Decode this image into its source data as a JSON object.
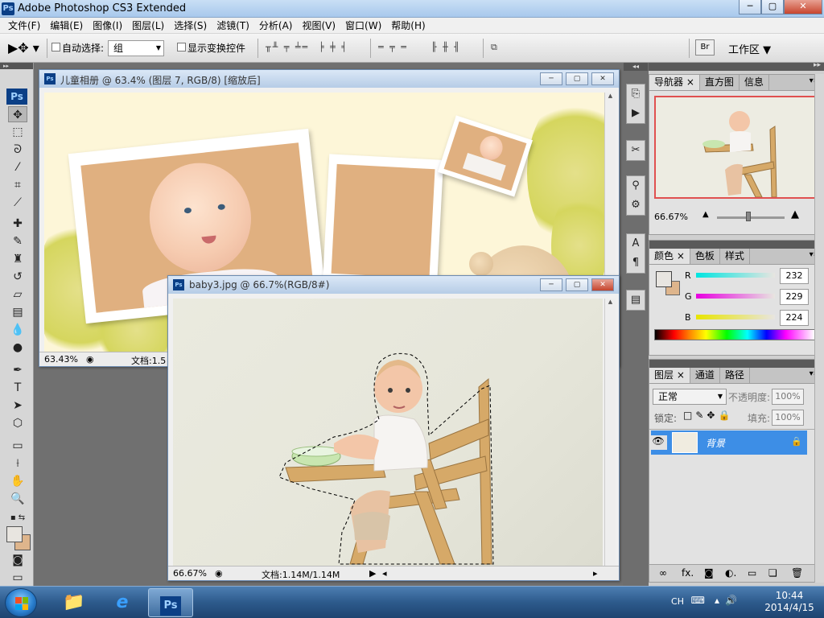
{
  "window": {
    "title": "Adobe Photoshop CS3 Extended",
    "app_icon": "Ps",
    "minimize": "─",
    "maximize": "▢",
    "close": "✕"
  },
  "menu": [
    "文件(F)",
    "编辑(E)",
    "图像(I)",
    "图层(L)",
    "选择(S)",
    "滤镜(T)",
    "分析(A)",
    "视图(V)",
    "窗口(W)",
    "帮助(H)"
  ],
  "options": {
    "auto_select_label": "自动选择:",
    "auto_select_value": "组",
    "show_transform_label": "显示变换控件",
    "workspace_label": "工作区 ▼",
    "bridge_icon": "Br"
  },
  "toolbox": {
    "logo": "Ps",
    "tools": [
      "move-tool",
      "marquee-tool",
      "lasso-tool",
      "magic-wand-tool",
      "crop-tool",
      "slice-tool",
      "healing-brush-tool",
      "brush-tool",
      "clone-stamp-tool",
      "history-brush-tool",
      "eraser-tool",
      "gradient-tool",
      "blur-tool",
      "dodge-tool",
      "pen-tool",
      "type-tool",
      "path-selection-tool",
      "shape-tool",
      "notes-tool",
      "eyedropper-tool",
      "hand-tool",
      "zoom-tool"
    ],
    "foreground_color": "#e8e5e0",
    "background_color": "#deb58c"
  },
  "doc1": {
    "title": "儿童相册 @ 63.4% (图层 7, RGB/8) [缩放后]",
    "zoom": "63.43%",
    "doc_info": "文档:1.5"
  },
  "doc2": {
    "title": "baby3.jpg @ 66.7%(RGB/8#)",
    "zoom": "66.67%",
    "doc_info": "文档:1.14M/1.14M"
  },
  "navigator": {
    "tabs": [
      "导航器",
      "直方图",
      "信息"
    ],
    "zoom": "66.67%"
  },
  "color": {
    "tabs": [
      "颜色",
      "色板",
      "样式"
    ],
    "channels": [
      {
        "label": "R",
        "value": "232"
      },
      {
        "label": "G",
        "value": "229"
      },
      {
        "label": "B",
        "value": "224"
      }
    ]
  },
  "layers": {
    "tabs": [
      "图层",
      "通道",
      "路径"
    ],
    "blend_mode": "正常",
    "opacity_label": "不透明度:",
    "opacity_value": "100%",
    "lock_label": "锁定:",
    "fill_label": "填充:",
    "fill_value": "100%",
    "layer_name": "背景"
  },
  "taskbar": {
    "time": "10:44",
    "date": "2014/4/15",
    "lang": "CH"
  }
}
